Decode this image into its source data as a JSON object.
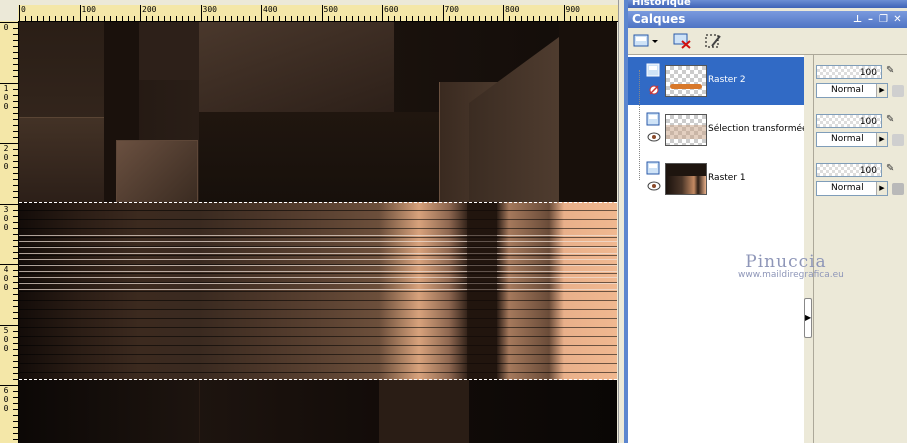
{
  "rulers": {
    "horizontal": [
      "0",
      "100",
      "200",
      "300",
      "400",
      "500",
      "600",
      "700",
      "800",
      "900"
    ],
    "vertical": [
      [
        "0"
      ],
      [
        "1",
        "0",
        "0"
      ],
      [
        "2",
        "0",
        "0"
      ],
      [
        "3",
        "0",
        "0"
      ],
      [
        "4",
        "0",
        "0"
      ],
      [
        "5",
        "0",
        "0"
      ],
      [
        "6",
        "0",
        "0"
      ]
    ]
  },
  "panels": {
    "history_title": "Historique",
    "layers_title": "Calques"
  },
  "layers": [
    {
      "name": "Raster 2",
      "opacity": "100",
      "blend": "Normal",
      "selected": true
    },
    {
      "name": "Sélection transformée",
      "opacity": "100",
      "blend": "Normal",
      "selected": false
    },
    {
      "name": "Raster 1",
      "opacity": "100",
      "blend": "Normal",
      "selected": false
    }
  ],
  "watermark": {
    "title": "Pinuccia",
    "url": "www.maildiregrafica.eu"
  },
  "colors": {
    "accent": "#316ac5",
    "title_bar": "#4f74c4",
    "canvas_dark": "#1b120d",
    "copper": "#e9b08a"
  },
  "icons": [
    "new-layer-icon",
    "delete-layer-icon",
    "mask-icon",
    "eye-icon",
    "brush-icon",
    "lock-icon"
  ]
}
